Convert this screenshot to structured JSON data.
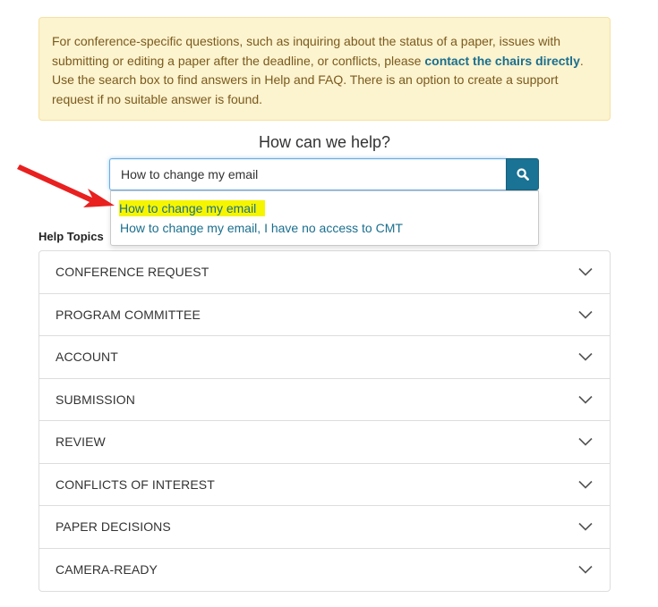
{
  "notice": {
    "text_before": "For conference-specific questions, such as inquiring about the status of a paper, issues with submitting or editing a paper after the deadline, or conflicts, please ",
    "link": "contact the chairs directly",
    "text_after": ". Use the search box to find answers in Help and FAQ. There is an option to create a support request if no suitable answer is found."
  },
  "search": {
    "heading": "How can we help?",
    "value": "How to change my email",
    "button_icon": "search-icon",
    "suggestions": [
      "How to change my email",
      "How to change my email, I have no access to CMT"
    ]
  },
  "help_topics": {
    "label": "Help Topics",
    "items": [
      "CONFERENCE REQUEST",
      "PROGRAM COMMITTEE",
      "ACCOUNT",
      "SUBMISSION",
      "REVIEW",
      "CONFLICTS OF INTEREST",
      "PAPER DECISIONS",
      "CAMERA-READY"
    ]
  },
  "colors": {
    "notice_bg": "#fcf3cf",
    "link": "#1a6f8e",
    "search_button": "#1a7294",
    "highlight": "#f6f500",
    "annotation_arrow": "#e8201f"
  }
}
